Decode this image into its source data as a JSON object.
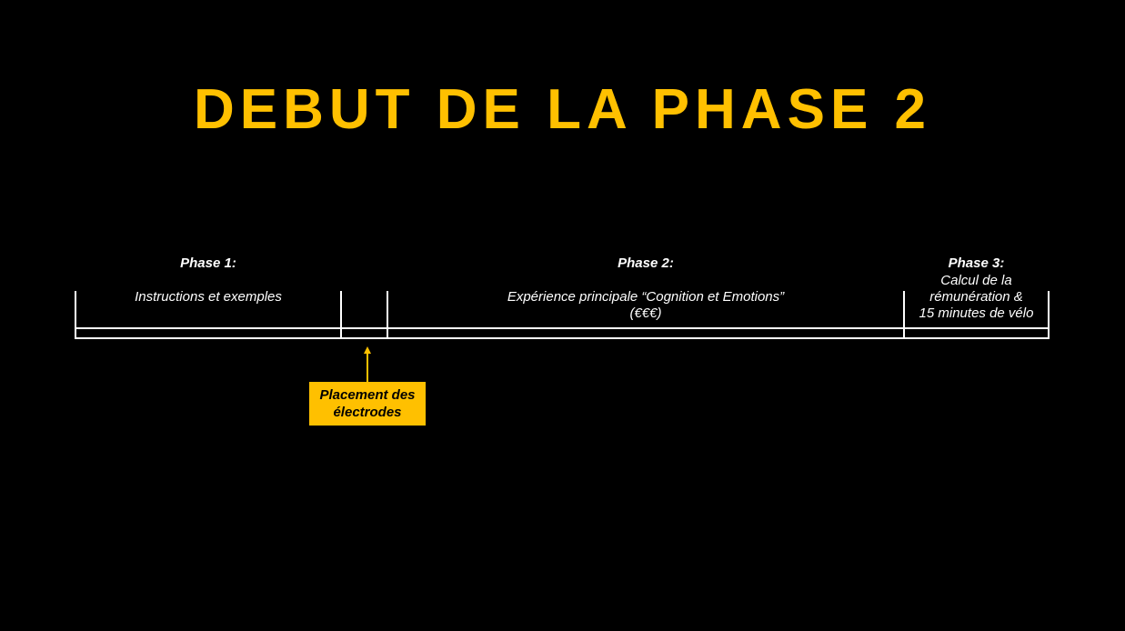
{
  "colors": {
    "background": "#000000",
    "accent": "#ffc000",
    "text": "#ffffff"
  },
  "slide": {
    "title": "DEBUT DE LA PHASE 2"
  },
  "timeline": {
    "phase1": {
      "heading": "Phase 1:",
      "description": "Instructions et exemples"
    },
    "phase2": {
      "heading": "Phase 2:",
      "description_line1": "Expérience principale “Cognition et Emotions”",
      "description_line2": "(€€€)"
    },
    "phase3": {
      "heading": "Phase 3:",
      "description_line1": "Calcul de la",
      "description_line2": "rémunération &",
      "description_line3": "15 minutes de vélo"
    },
    "callout": {
      "line1": "Placement des",
      "line2": "électrodes"
    }
  }
}
